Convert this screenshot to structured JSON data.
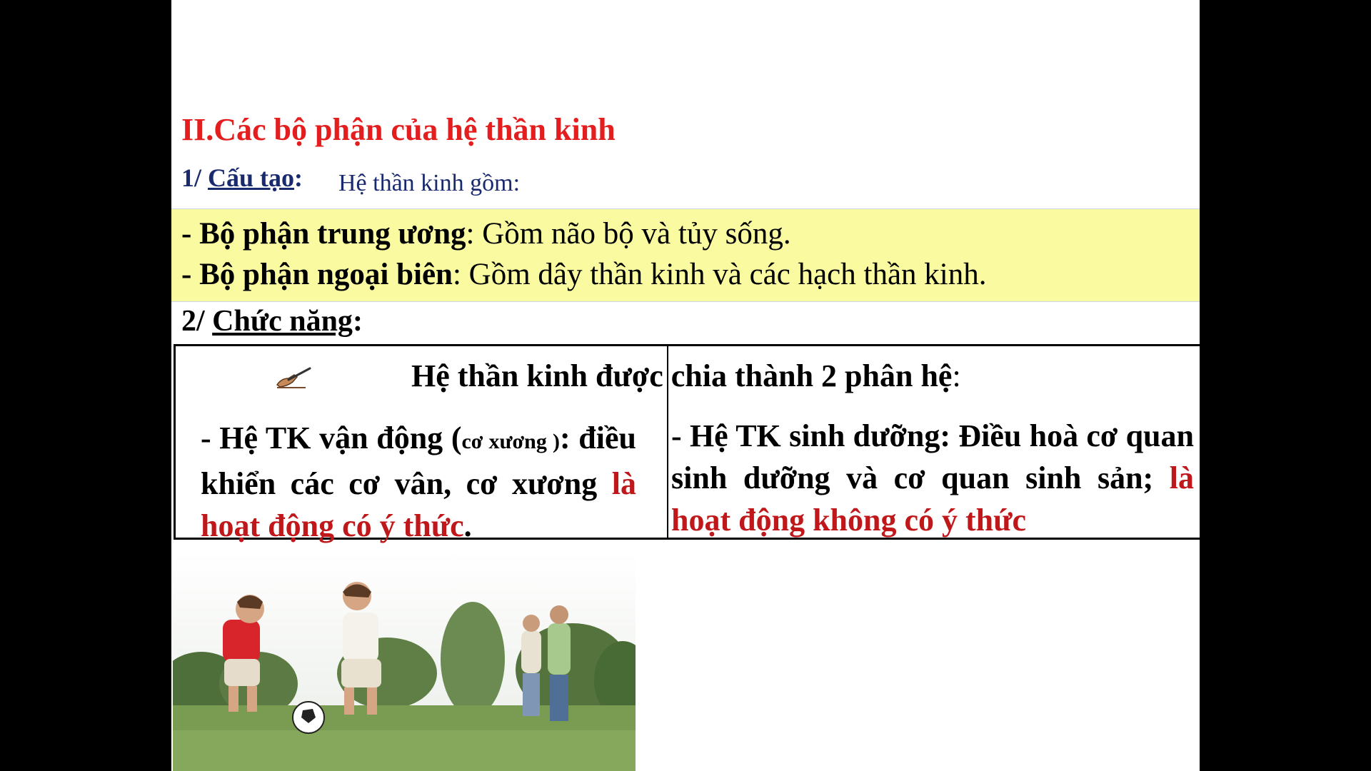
{
  "section_title": "II.Các bộ phận của hệ thần kinh",
  "structure": {
    "heading_prefix": "1/ ",
    "heading_label": "Cấu tạo",
    "heading_colon": ":",
    "intro": "Hệ thần kinh gồm:"
  },
  "parts": [
    {
      "label": "- Bộ phận trung ương",
      "text": ": Gồm não bộ và tủy sống."
    },
    {
      "label": "- Bộ phận ngoại biên",
      "text": ": Gồm dây thần kinh và các hạch thần kinh."
    }
  ],
  "function": {
    "heading_prefix": "2/ ",
    "heading_label": "Chức năng",
    "heading_colon": ":"
  },
  "table": {
    "header": "Hệ thần kinh được chia thành 2 phân hệ",
    "header_colon": ":",
    "left": {
      "part1": "- Hệ TK vận động (",
      "small": "cơ xương )",
      "part2": ": điều khiển các cơ vân, cơ xương ",
      "highlight": "là hoạt động có ý thức",
      "end": "."
    },
    "right": {
      "part1": "- Hệ TK sinh dưỡng: Điều hoà cơ quan sinh dưỡng và cơ quan sinh sản; ",
      "highlight": "là hoạt động không có ý thức"
    }
  },
  "colors": {
    "title_red": "#e41e1e",
    "heading_navy": "#1a2a6e",
    "highlight_yellow": "#fafaa0",
    "text_red": "#c0181a"
  },
  "icons": [
    "writing-hand-icon"
  ],
  "image": "photo-children-playing-football"
}
